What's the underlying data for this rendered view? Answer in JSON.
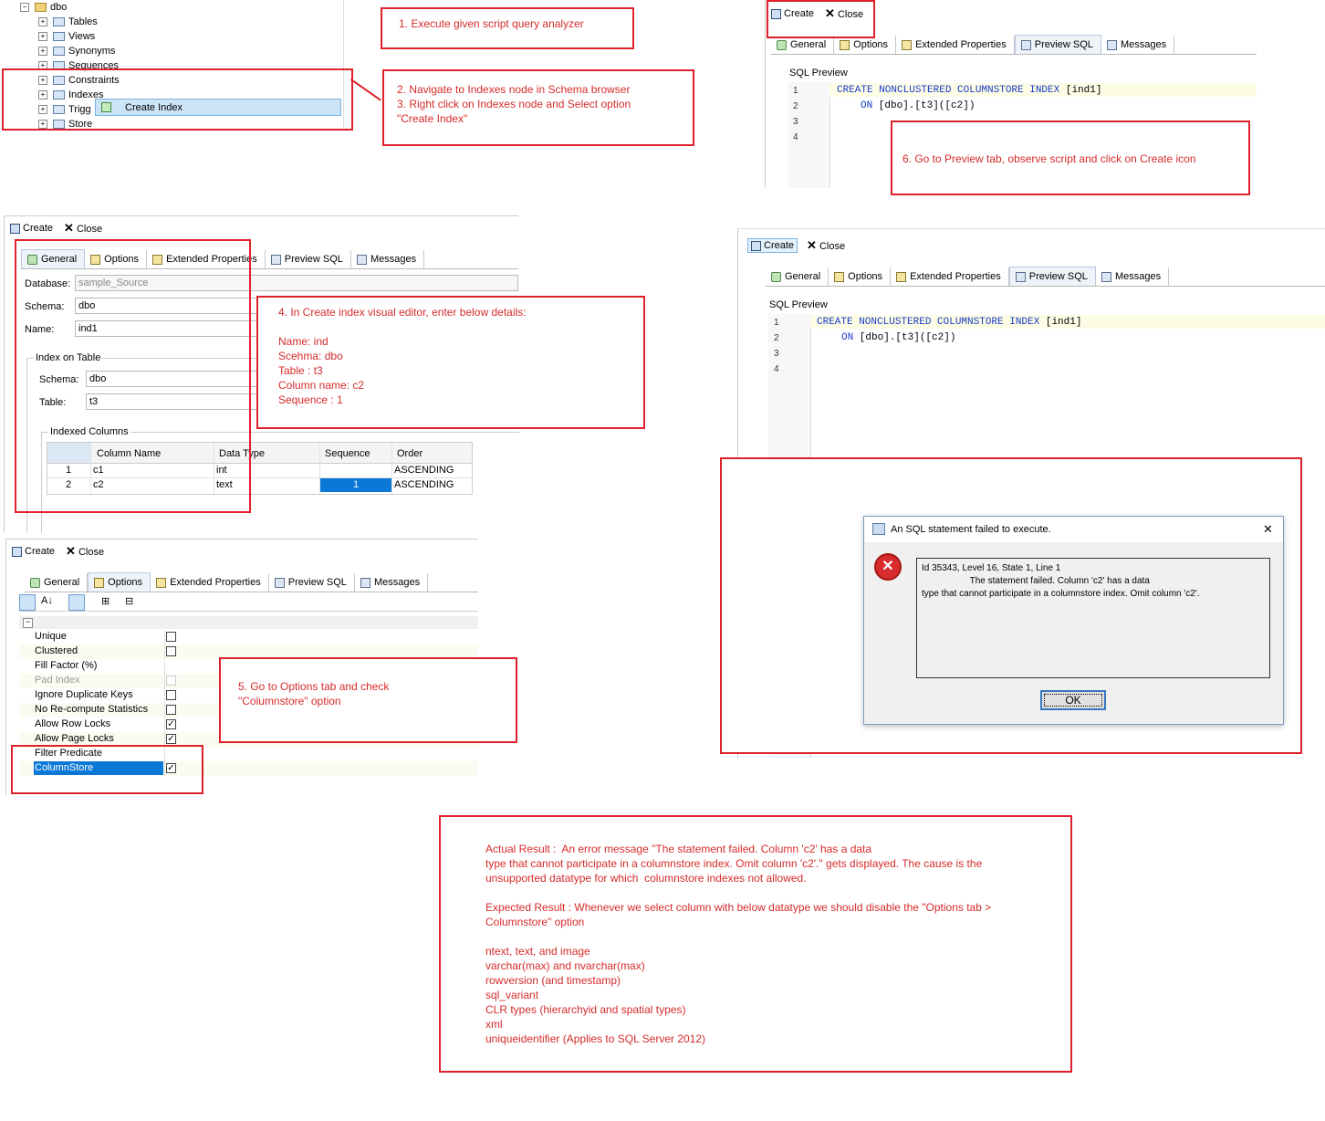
{
  "tree": {
    "root": "dbo",
    "items": [
      "Tables",
      "Views",
      "Synonyms",
      "Sequences",
      "Constraints",
      "Indexes",
      "Trigg",
      "Store"
    ],
    "context_menu": "Create Index"
  },
  "notes": {
    "n1": "1. Execute given script query analyzer",
    "n2": "2. Navigate to Indexes node in Schema browser\n3. Right click on Indexes node and Select option\n\"Create Index\"",
    "n4": "4. In Create index visual editor, enter below details:\n\nName: ind\nScehma: dbo\nTable : t3\nColumn name: c2\nSequence : 1",
    "n5": "5. Go to Options tab and check\n\"Columnstore\" option",
    "n6": "6. Go to Preview tab, observe script and click on Create icon",
    "result": "Actual Result :  An error message \"The statement failed. Column 'c2' has a data\ntype that cannot participate in a columnstore index. Omit column 'c2'.\" gets displayed. The cause is the\nunsupported datatype for which  columnstore indexes not allowed.\n\nExpected Result : Whenever we select column with below datatype we should disable the \"Options tab >\nColumnstore\" option\n\nntext, text, and image\nvarchar(max) and nvarchar(max)\nrowversion (and timestamp)\nsql_variant\nCLR types (hierarchyid and spatial types)\nxml\nuniqueidentifier (Applies to SQL Server 2012)"
  },
  "toolbar": {
    "create": "Create",
    "close": "Close"
  },
  "tabs": [
    "General",
    "Options",
    "Extended Properties",
    "Preview SQL",
    "Messages"
  ],
  "general": {
    "database_label": "Database:",
    "database_value": "sample_Source",
    "schema_label": "Schema:",
    "schema_value": "dbo",
    "name_label": "Name:",
    "name_value": "ind1",
    "index_on_table": "Index on Table",
    "table_schema_label": "Schema:",
    "table_schema_value": "dbo",
    "table_label": "Table:",
    "table_value": "t3",
    "indexed_columns": "Indexed Columns",
    "columns": [
      "Column Name",
      "Data Type",
      "Sequence",
      "Order"
    ],
    "rows": [
      {
        "num": "1",
        "name": "c1",
        "type": "int",
        "seq": "",
        "order": "ASCENDING"
      },
      {
        "num": "2",
        "name": "c2",
        "type": "text",
        "seq": "1",
        "order": "ASCENDING"
      }
    ]
  },
  "options": {
    "items": [
      {
        "label": "Unique",
        "checked": ""
      },
      {
        "label": "Clustered",
        "checked": ""
      },
      {
        "label": "Fill Factor (%)",
        "checked": ""
      },
      {
        "label": "Pad Index",
        "checked": ""
      },
      {
        "label": "Ignore Duplicate Keys",
        "checked": ""
      },
      {
        "label": "No Re-compute Statistics",
        "checked": ""
      },
      {
        "label": "Allow Row Locks",
        "checked": "✓"
      },
      {
        "label": "Allow Page Locks",
        "checked": "✓"
      },
      {
        "label": "Filter Predicate",
        "checked": ""
      },
      {
        "label": "ColumnStore",
        "checked": "✓"
      }
    ]
  },
  "preview": {
    "label": "SQL Preview",
    "line_numbers": [
      "1",
      "2",
      "3",
      "4"
    ],
    "line1_kw": "CREATE NONCLUSTERED COLUMNSTORE INDEX",
    "line1_rest": " [ind1]",
    "line2_kw": "ON",
    "line2_rest": " [dbo].[t3]([c2])"
  },
  "dialog": {
    "title": "An SQL statement failed to execute.",
    "close": "✕",
    "message": "Id 35343, Level 16, State 1, Line 1\n                   The statement failed. Column 'c2' has a data\ntype that cannot participate in a columnstore index. Omit column 'c2'.",
    "ok": "OK"
  }
}
